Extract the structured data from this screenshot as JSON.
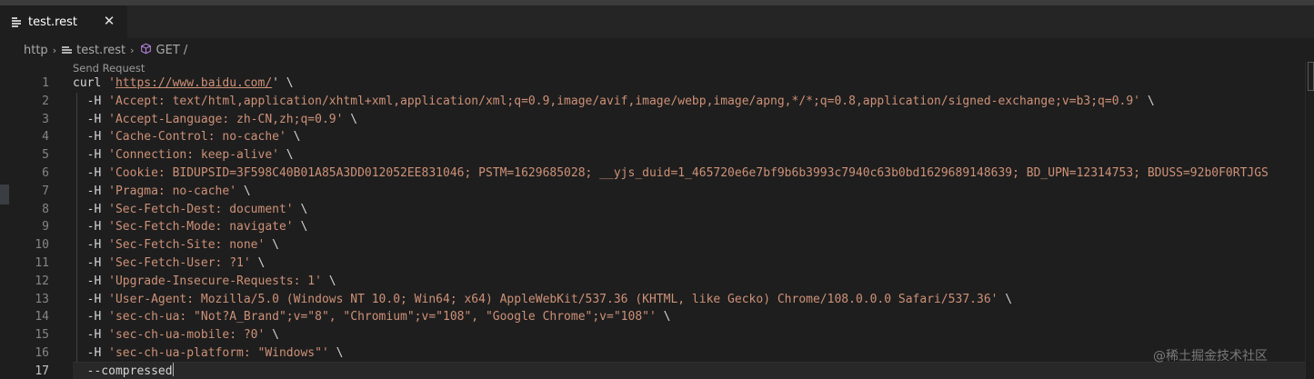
{
  "tab": {
    "label": "test.rest",
    "close_glyph": "✕",
    "icon": "file-lines-icon"
  },
  "breadcrumb": {
    "items": [
      "http",
      "test.rest",
      "GET /"
    ],
    "separator": "›",
    "icons": [
      "file-lines-icon",
      "cube-icon"
    ]
  },
  "codelens": "Send Request",
  "editor": {
    "active_line": 17,
    "lines": [
      {
        "n": "1",
        "plain": "curl ",
        "url": "https://www.baidu.com/",
        "tail": "' \\"
      },
      {
        "n": "2",
        "pre": "  -H ",
        "str": "'Accept: text/html,application/xhtml+xml,application/xml;q=0.9,image/avif,image/webp,image/apng,*/*;q=0.8,application/signed-exchange;v=b3;q=0.9'",
        "tail": " \\"
      },
      {
        "n": "3",
        "pre": "  -H ",
        "str": "'Accept-Language: zh-CN,zh;q=0.9'",
        "tail": " \\"
      },
      {
        "n": "4",
        "pre": "  -H ",
        "str": "'Cache-Control: no-cache'",
        "tail": " \\"
      },
      {
        "n": "5",
        "pre": "  -H ",
        "str": "'Connection: keep-alive'",
        "tail": " \\"
      },
      {
        "n": "6",
        "pre": "  -H ",
        "str": "'Cookie: BIDUPSID=3F598C40B01A85A3DD012052EE831046; PSTM=1629685028; __yjs_duid=1_465720e6e7bf9b6b3993c7940c63b0bd1629689148639; BD_UPN=12314753; BDUSS=92b0F0RTJGS",
        "tail": ""
      },
      {
        "n": "7",
        "pre": "  -H ",
        "str": "'Pragma: no-cache'",
        "tail": " \\"
      },
      {
        "n": "8",
        "pre": "  -H ",
        "str": "'Sec-Fetch-Dest: document'",
        "tail": " \\"
      },
      {
        "n": "9",
        "pre": "  -H ",
        "str": "'Sec-Fetch-Mode: navigate'",
        "tail": " \\"
      },
      {
        "n": "10",
        "pre": "  -H ",
        "str": "'Sec-Fetch-Site: none'",
        "tail": " \\"
      },
      {
        "n": "11",
        "pre": "  -H ",
        "str": "'Sec-Fetch-User: ?1'",
        "tail": " \\"
      },
      {
        "n": "12",
        "pre": "  -H ",
        "str": "'Upgrade-Insecure-Requests: 1'",
        "tail": " \\"
      },
      {
        "n": "13",
        "pre": "  -H ",
        "str": "'User-Agent: Mozilla/5.0 (Windows NT 10.0; Win64; x64) AppleWebKit/537.36 (KHTML, like Gecko) Chrome/108.0.0.0 Safari/537.36'",
        "tail": " \\"
      },
      {
        "n": "14",
        "pre": "  -H ",
        "str": "'sec-ch-ua: \"Not?A_Brand\";v=\"8\", \"Chromium\";v=\"108\", \"Google Chrome\";v=\"108\"'",
        "tail": " \\"
      },
      {
        "n": "15",
        "pre": "  -H ",
        "str": "'sec-ch-ua-mobile: ?0'",
        "tail": " \\"
      },
      {
        "n": "16",
        "pre": "  -H ",
        "str": "'sec-ch-ua-platform: \"Windows\"'",
        "tail": " \\"
      },
      {
        "n": "17",
        "pre": "  --compressed",
        "str": "",
        "tail": ""
      }
    ]
  },
  "watermark": "@稀土掘金技术社区",
  "colors": {
    "background": "#1e1e1e",
    "string": "#ce9178",
    "text": "#d4d4d4",
    "line_number": "#858585"
  }
}
